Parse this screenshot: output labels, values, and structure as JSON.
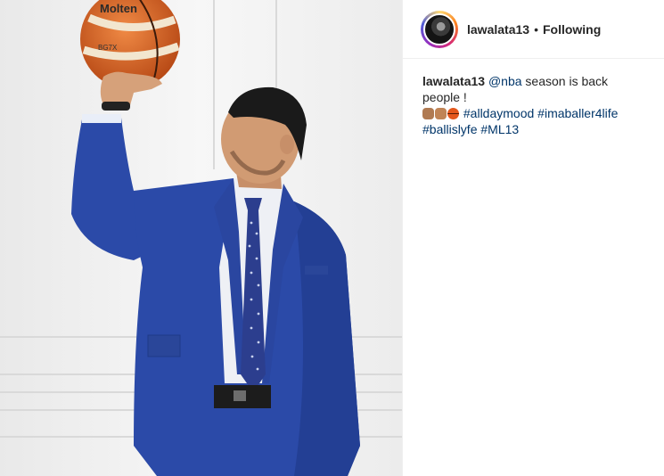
{
  "post": {
    "username": "lawalata13",
    "separator": "•",
    "follow_state": "Following"
  },
  "caption": {
    "username": "lawalata13",
    "mention": "@nba",
    "text": " season is back people !",
    "emojis": [
      "fist-bump-emoji",
      "fist-emoji",
      "basketball-emoji"
    ],
    "hashtags": [
      "#alldaymood",
      "#imaballer4life",
      "#ballislyfe",
      "#ML13"
    ]
  },
  "photo": {
    "ball_text": "Molten",
    "ball_model": "BG7X"
  },
  "colors": {
    "suit": "#2b4aa8",
    "link": "#003569",
    "ball": "#d9652b"
  }
}
